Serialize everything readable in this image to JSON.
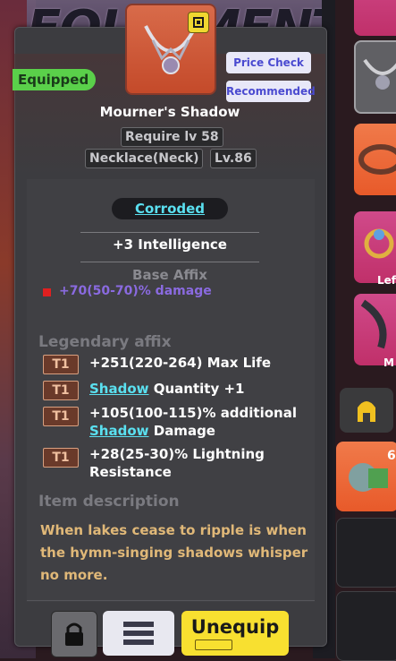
{
  "item": {
    "name": "Mourner's Shadow",
    "require_level": "Require lv 58",
    "slot_type": "Necklace(Neck)",
    "item_level": "Lv.86",
    "status_badge": "Equipped",
    "corruption": "Corroded",
    "main_stat": "+3 Intelligence"
  },
  "buttons": {
    "price_check": "Price Check",
    "recommended": "Recommended",
    "unequip": "Unequip"
  },
  "sections": {
    "base_affix_title": "Base Affix",
    "legendary_title": "Legendary affix",
    "description_title": "Item description"
  },
  "base_affix": {
    "text": "+70(50-70)% damage"
  },
  "legendary_affixes": [
    {
      "tier": "T1",
      "text": "+251(220-264) Max Life"
    },
    {
      "tier": "T1",
      "keyword": "Shadow",
      "text": " Quantity +1"
    },
    {
      "tier": "T1",
      "line1": "+105(100-115)% additional",
      "keyword": "Shadow",
      "line2": " Damage"
    },
    {
      "tier": "T1",
      "line1": "+28(25-30)% Lightning",
      "line2": "Resistance"
    }
  ],
  "description": "When lakes cease to ripple is when the hymn-singing shadows whisper no more.",
  "side_panel": {
    "label_left": "Lef",
    "label_m": "M",
    "count": "6"
  },
  "background_title": "EQUIPMENT"
}
